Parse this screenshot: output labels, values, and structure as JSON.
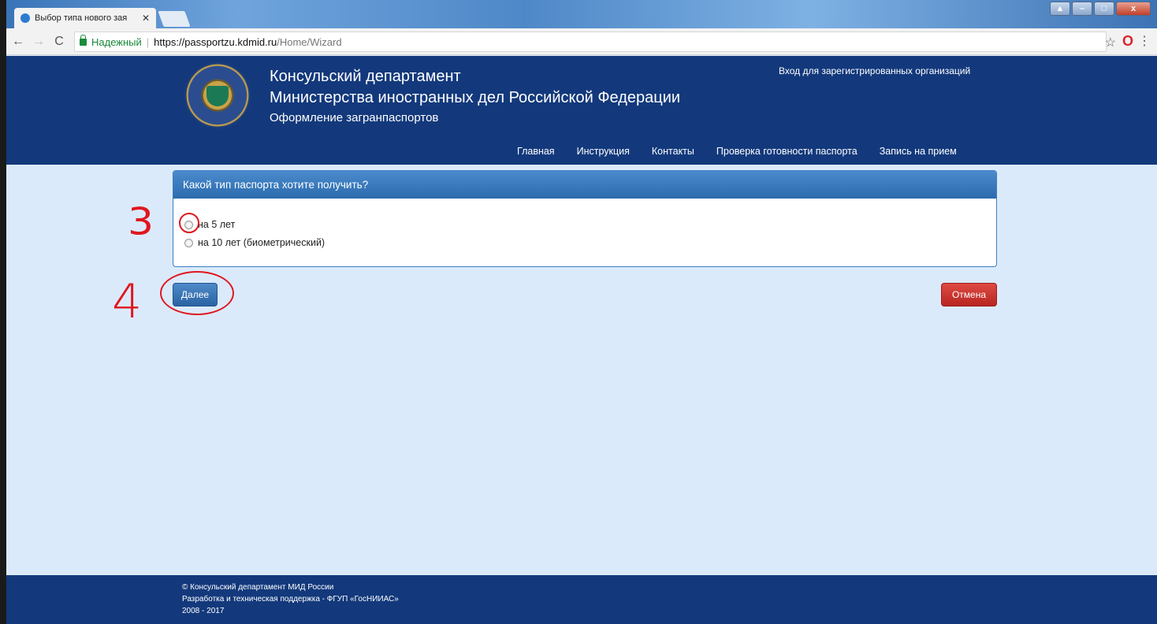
{
  "browser": {
    "tab_title": "Выбор типа нового зая",
    "tab_close": "✕",
    "nav": {
      "back": "←",
      "forward": "→",
      "reload": "C"
    },
    "secure_label": "Надежный",
    "separator": "|",
    "url_host": "https://passportzu.kdmid.ru",
    "url_path": "/Home/Wizard",
    "bookmark_icon": "☆",
    "opera_icon": "O",
    "menu_icon": "⋮",
    "window_controls": [
      "▲",
      "–",
      "□",
      "x"
    ]
  },
  "header": {
    "org_line1": "Консульский департамент",
    "org_line2": "Министерства иностранных дел Российской Федерации",
    "org_line3": "Оформление загранпаспортов",
    "login_link": "Вход для зарегистрированных организаций",
    "nav": [
      "Главная",
      "Инструкция",
      "Контакты",
      "Проверка готовности паспорта",
      "Запись на прием"
    ],
    "colors": {
      "header_bg": "#13397c",
      "page_bg": "#dbeafb"
    }
  },
  "form": {
    "question": "Какой тип паспорта хотите получить?",
    "options": [
      "на 5 лет",
      "на 10 лет (биометрический)"
    ],
    "next_button": "Далее",
    "cancel_button": "Отмена"
  },
  "annotations": {
    "step3": "3",
    "step4": "4",
    "color": "#e0161e"
  },
  "footer": {
    "line1": "© Консульский департамент МИД России",
    "line2": "Разработка и техническая поддержка - ФГУП «ГосНИИАС»",
    "line3": "2008 - 2017"
  }
}
